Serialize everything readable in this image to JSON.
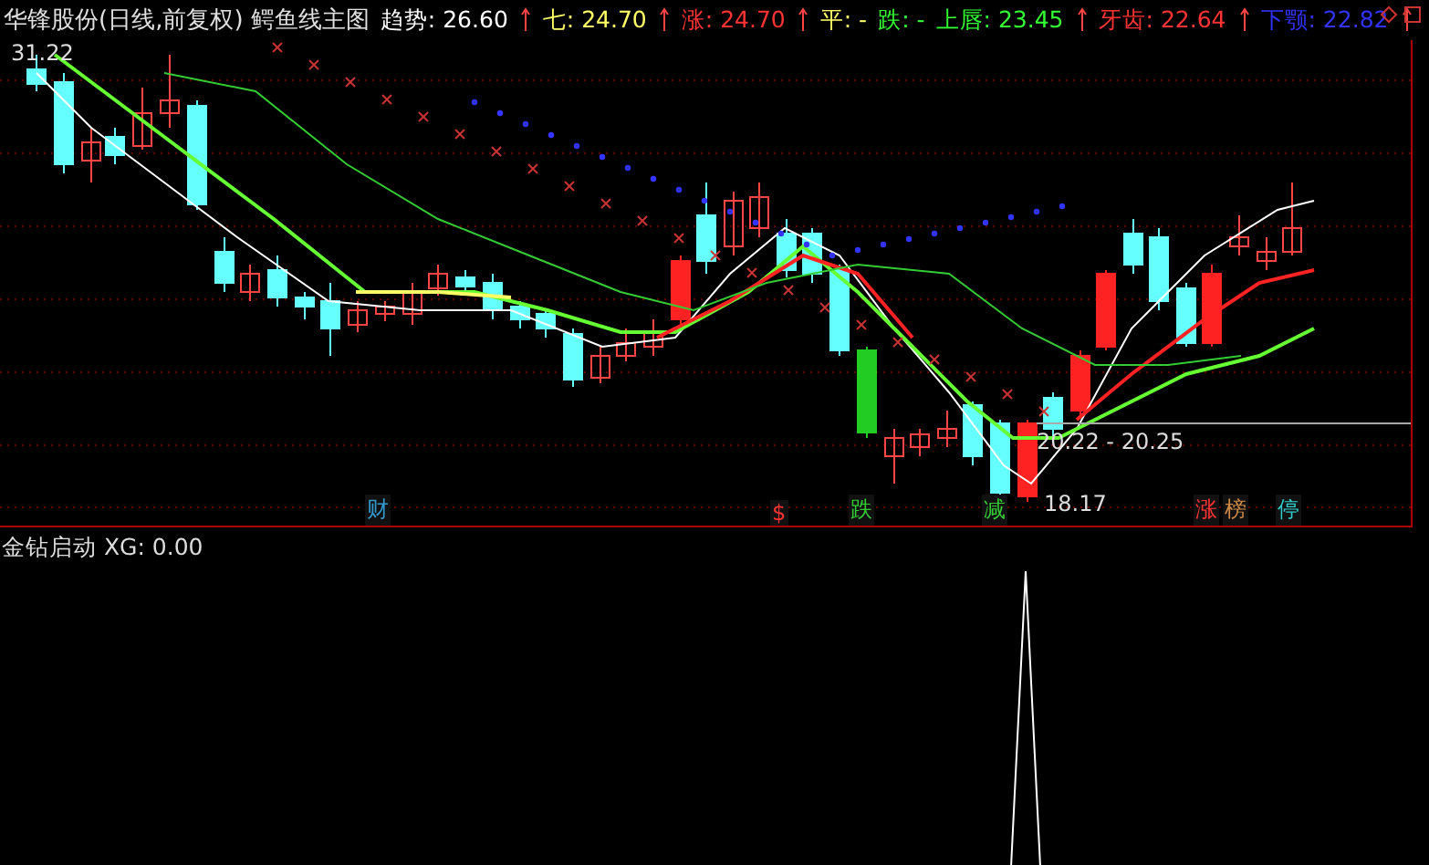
{
  "main_chart": {
    "title": "华锋股份(日线,前复权) 鳄鱼线主图",
    "legends": [
      {
        "label": "趋势: 26.60",
        "color": "#ffffff"
      },
      {
        "label": "七: 24.70",
        "color": "#ffff66"
      },
      {
        "label": "涨: 24.70",
        "color": "#ff3333"
      },
      {
        "label": "平: -",
        "color": "#ffff66"
      },
      {
        "label": "跌: -",
        "color": "#33ff33"
      },
      {
        "label": "上唇: 23.45",
        "color": "#33ff33"
      },
      {
        "label": "牙齿: 22.64",
        "color": "#ff3333"
      },
      {
        "label": "下颚: 22.82",
        "color": "#3333ff"
      }
    ],
    "high_label": "31.22",
    "range_label": "20.22 - 20.25",
    "low_label": "18.17",
    "event_tags": [
      {
        "label": "财",
        "color": "#3399cc"
      },
      {
        "label": "$",
        "color": "#ff3333"
      },
      {
        "label": "跌",
        "color": "#33cc33"
      },
      {
        "label": "减",
        "color": "#33cc33"
      },
      {
        "label": "涨",
        "color": "#ff3333"
      },
      {
        "label": "榜",
        "color": "#cc8844"
      },
      {
        "label": "停",
        "color": "#33cccc"
      }
    ]
  },
  "indicator_panel": {
    "title": "金钻启动 XG: 0.00"
  }
}
